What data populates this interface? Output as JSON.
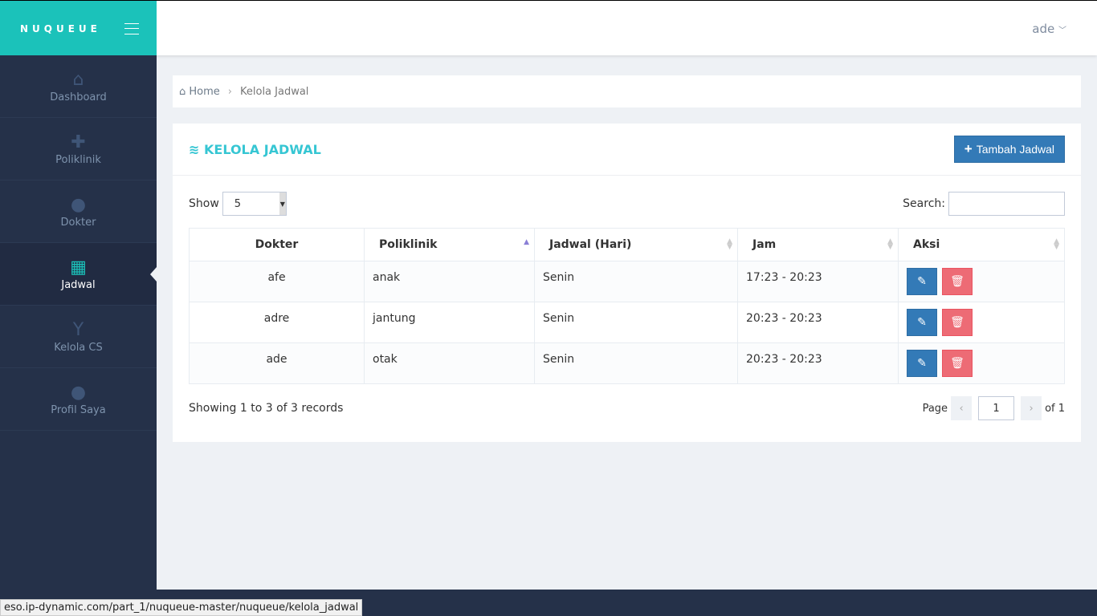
{
  "brand": "NUQUEUE",
  "user": "ade",
  "sidebar": {
    "items": [
      {
        "label": "Dashboard",
        "icon": "home-icon",
        "glyph": "⌂"
      },
      {
        "label": "Poliklinik",
        "icon": "medkit-icon",
        "glyph": "✚"
      },
      {
        "label": "Dokter",
        "icon": "user-md-icon",
        "glyph": "●"
      },
      {
        "label": "Jadwal",
        "icon": "calendar-icon",
        "glyph": "▦"
      },
      {
        "label": "Kelola CS",
        "icon": "child-icon",
        "glyph": "Y"
      },
      {
        "label": "Profil Saya",
        "icon": "user-icon",
        "glyph": "●"
      }
    ]
  },
  "breadcrumb": {
    "home": "Home",
    "current": "Kelola Jadwal"
  },
  "card": {
    "title": "KELOLA JADWAL",
    "add_label": "Tambah Jadwal"
  },
  "controls": {
    "show_label": "Show",
    "page_size": "5",
    "search_label": "Search:",
    "search_value": ""
  },
  "table": {
    "headers": [
      "Dokter",
      "Poliklinik",
      "Jadwal (Hari)",
      "Jam",
      "Aksi"
    ],
    "rows": [
      [
        "afe",
        "anak",
        "Senin",
        "17:23 - 20:23"
      ],
      [
        "adre",
        "jantung",
        "Senin",
        "20:23 - 20:23"
      ],
      [
        "ade",
        "otak",
        "Senin",
        "20:23 - 20:23"
      ]
    ]
  },
  "footer": {
    "info": "Showing 1 to 3 of 3 records",
    "page_label": "Page",
    "page": "1",
    "of_label": "of 1"
  },
  "status_url": "eso.ip-dynamic.com/part_1/nuqueue-master/nuqueue/kelola_jadwal",
  "colors": {
    "brand": "#1bc2ba",
    "sidebar": "#253149",
    "title": "#36c6d3",
    "primary": "#337ab7",
    "danger": "#ed6b75"
  }
}
